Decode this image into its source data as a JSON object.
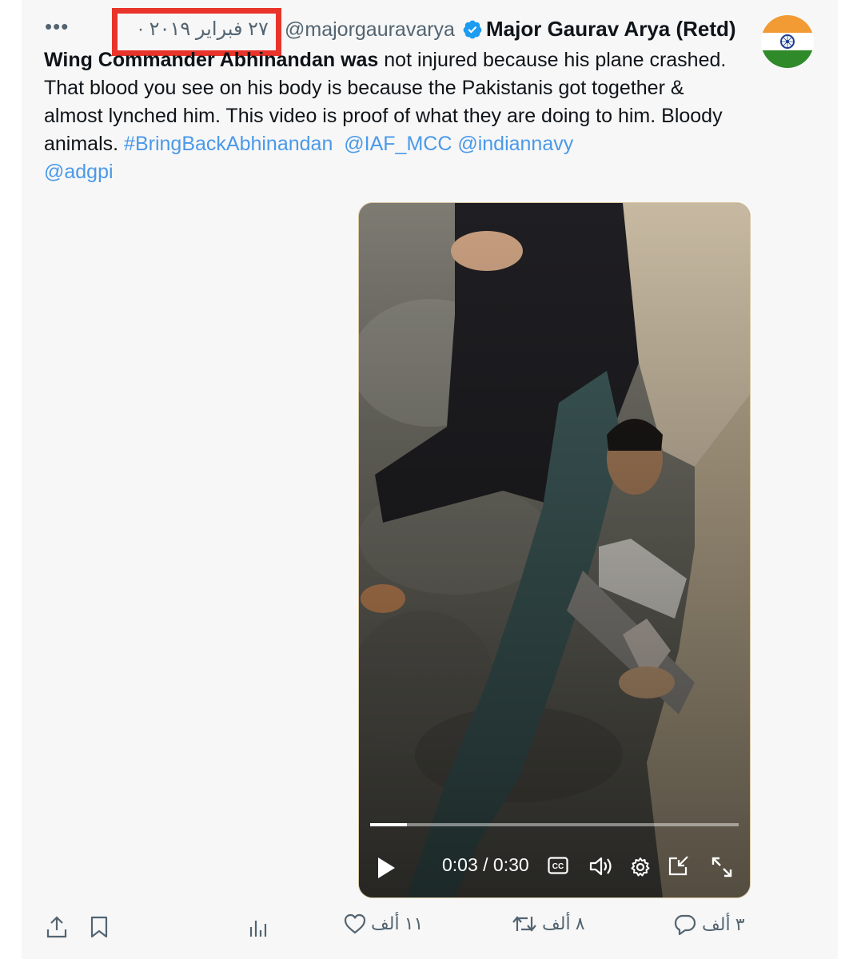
{
  "tweet": {
    "more_label": "•••",
    "date": "٢٧ فبراير ٢٠١٩ ·",
    "handle": "@majorgauravarya",
    "display_name": "Major Gaurav Arya (Retd)",
    "text_bold": "Wing Commander Abhinandan was",
    "text_rest": " not injured because his plane crashed. That blood you see on his body is because the Pakistanis got together & almost lynched him. This video is proof of what they are doing to him. Bloody animals. ",
    "hashtag": "#BringBackAbhinandan",
    "mention1": "@IAF_MCC",
    "mention2": "@indiannavy",
    "mention3": "@adgpi"
  },
  "video": {
    "time": "0:03 / 0:30",
    "progress": 0.1
  },
  "actions": {
    "replies": "٣ ألف",
    "retweets": "٨ ألف",
    "likes": "١١ ألف"
  },
  "icons": {
    "verified": "verified-badge-icon",
    "avatar": "india-flag-avatar"
  },
  "colors": {
    "highlight": "#e8342a",
    "link": "#4a99e9",
    "verified": "#1d9bf0"
  }
}
